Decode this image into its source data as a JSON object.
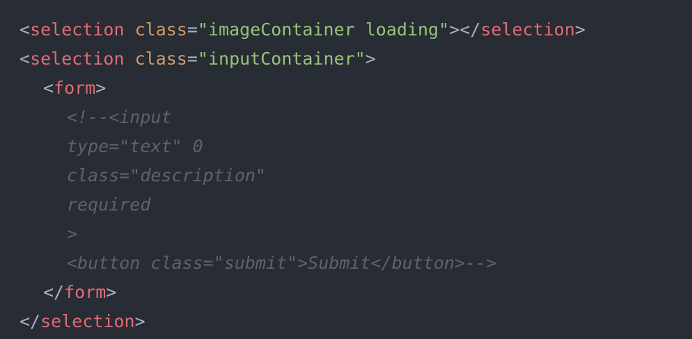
{
  "colors": {
    "background": "#282c34",
    "punctuation": "#abb2bf",
    "tag": "#e06c75",
    "attribute": "#d19a66",
    "string": "#98c379",
    "comment": "#5c6370"
  },
  "code": {
    "line1": {
      "open": "<",
      "tag": "selection",
      "space": " ",
      "attr": "class",
      "eq": "=",
      "value": "\"imageContainer loading\"",
      "close_open": "></",
      "close_tag": "selection",
      "end": ">"
    },
    "line2": {
      "open": "<",
      "tag": "selection",
      "space": " ",
      "attr": "class",
      "eq": "=",
      "value": "\"inputContainer\"",
      "end": ">"
    },
    "line3": {
      "open": "<",
      "tag": "form",
      "end": ">"
    },
    "comment_lines": [
      "<!--<input",
      "type=\"text\" 0",
      "class=\"description\"",
      "required",
      ">",
      "<button class=\"submit\">Submit</button>-->"
    ],
    "line10": {
      "open": "</",
      "tag": "form",
      "end": ">"
    },
    "line11": {
      "open": "</",
      "tag": "selection",
      "end": ">"
    }
  }
}
